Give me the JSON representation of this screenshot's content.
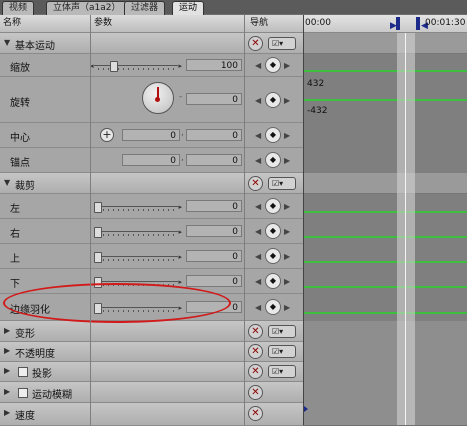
{
  "tabs": [
    "视频",
    "立体声（a1a2）",
    "过滤器",
    "运动"
  ],
  "header": {
    "name": "名称",
    "params": "参数",
    "nav": "导航",
    "time_start": "00:00",
    "time_end": "00:01:30"
  },
  "sections": {
    "basic": "基本运动",
    "crop": "裁剪",
    "distort": "变形",
    "opacity": "不透明度",
    "shadow": "投影",
    "motion_blur": "运动模糊",
    "speed": "速度"
  },
  "params": {
    "scale": {
      "label": "缩放",
      "value": "100"
    },
    "rotation": {
      "label": "旋转",
      "value": "0"
    },
    "center": {
      "label": "中心",
      "x": "0",
      "y": "0"
    },
    "anchor": {
      "label": "锚点",
      "x": "0",
      "y": "0"
    },
    "left": {
      "label": "左",
      "value": "0"
    },
    "right": {
      "label": "右",
      "value": "0"
    },
    "top": {
      "label": "上",
      "value": "0"
    },
    "bottom": {
      "label": "下",
      "value": "0"
    },
    "edge_feather": {
      "label": "边缘羽化",
      "value": "0"
    }
  },
  "timeline": {
    "rotation_max": "432",
    "rotation_min": "-432"
  },
  "colors": {
    "curve": "#3fbf3f",
    "highlight_ring": "#d21a1a",
    "playhead": "#1c2a8a"
  },
  "icons": {
    "reset": "reset-x-icon",
    "menu": "menu-dropdown-icon",
    "keyframe": "keyframe-diamond-icon",
    "center": "crosshair-icon"
  }
}
